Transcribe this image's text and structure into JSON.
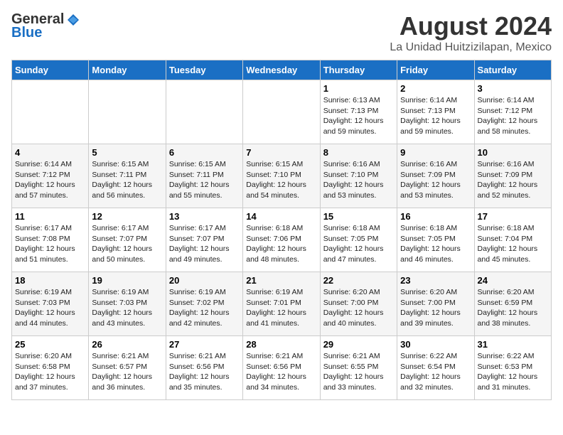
{
  "logo": {
    "general": "General",
    "blue": "Blue",
    "tagline": ""
  },
  "title": "August 2024",
  "subtitle": "La Unidad Huitzizilapan, Mexico",
  "days_of_week": [
    "Sunday",
    "Monday",
    "Tuesday",
    "Wednesday",
    "Thursday",
    "Friday",
    "Saturday"
  ],
  "weeks": [
    [
      {
        "day": "",
        "info": ""
      },
      {
        "day": "",
        "info": ""
      },
      {
        "day": "",
        "info": ""
      },
      {
        "day": "",
        "info": ""
      },
      {
        "day": "1",
        "info": "Sunrise: 6:13 AM\nSunset: 7:13 PM\nDaylight: 12 hours\nand 59 minutes."
      },
      {
        "day": "2",
        "info": "Sunrise: 6:14 AM\nSunset: 7:13 PM\nDaylight: 12 hours\nand 59 minutes."
      },
      {
        "day": "3",
        "info": "Sunrise: 6:14 AM\nSunset: 7:12 PM\nDaylight: 12 hours\nand 58 minutes."
      }
    ],
    [
      {
        "day": "4",
        "info": "Sunrise: 6:14 AM\nSunset: 7:12 PM\nDaylight: 12 hours\nand 57 minutes."
      },
      {
        "day": "5",
        "info": "Sunrise: 6:15 AM\nSunset: 7:11 PM\nDaylight: 12 hours\nand 56 minutes."
      },
      {
        "day": "6",
        "info": "Sunrise: 6:15 AM\nSunset: 7:11 PM\nDaylight: 12 hours\nand 55 minutes."
      },
      {
        "day": "7",
        "info": "Sunrise: 6:15 AM\nSunset: 7:10 PM\nDaylight: 12 hours\nand 54 minutes."
      },
      {
        "day": "8",
        "info": "Sunrise: 6:16 AM\nSunset: 7:10 PM\nDaylight: 12 hours\nand 53 minutes."
      },
      {
        "day": "9",
        "info": "Sunrise: 6:16 AM\nSunset: 7:09 PM\nDaylight: 12 hours\nand 53 minutes."
      },
      {
        "day": "10",
        "info": "Sunrise: 6:16 AM\nSunset: 7:09 PM\nDaylight: 12 hours\nand 52 minutes."
      }
    ],
    [
      {
        "day": "11",
        "info": "Sunrise: 6:17 AM\nSunset: 7:08 PM\nDaylight: 12 hours\nand 51 minutes."
      },
      {
        "day": "12",
        "info": "Sunrise: 6:17 AM\nSunset: 7:07 PM\nDaylight: 12 hours\nand 50 minutes."
      },
      {
        "day": "13",
        "info": "Sunrise: 6:17 AM\nSunset: 7:07 PM\nDaylight: 12 hours\nand 49 minutes."
      },
      {
        "day": "14",
        "info": "Sunrise: 6:18 AM\nSunset: 7:06 PM\nDaylight: 12 hours\nand 48 minutes."
      },
      {
        "day": "15",
        "info": "Sunrise: 6:18 AM\nSunset: 7:05 PM\nDaylight: 12 hours\nand 47 minutes."
      },
      {
        "day": "16",
        "info": "Sunrise: 6:18 AM\nSunset: 7:05 PM\nDaylight: 12 hours\nand 46 minutes."
      },
      {
        "day": "17",
        "info": "Sunrise: 6:18 AM\nSunset: 7:04 PM\nDaylight: 12 hours\nand 45 minutes."
      }
    ],
    [
      {
        "day": "18",
        "info": "Sunrise: 6:19 AM\nSunset: 7:03 PM\nDaylight: 12 hours\nand 44 minutes."
      },
      {
        "day": "19",
        "info": "Sunrise: 6:19 AM\nSunset: 7:03 PM\nDaylight: 12 hours\nand 43 minutes."
      },
      {
        "day": "20",
        "info": "Sunrise: 6:19 AM\nSunset: 7:02 PM\nDaylight: 12 hours\nand 42 minutes."
      },
      {
        "day": "21",
        "info": "Sunrise: 6:19 AM\nSunset: 7:01 PM\nDaylight: 12 hours\nand 41 minutes."
      },
      {
        "day": "22",
        "info": "Sunrise: 6:20 AM\nSunset: 7:00 PM\nDaylight: 12 hours\nand 40 minutes."
      },
      {
        "day": "23",
        "info": "Sunrise: 6:20 AM\nSunset: 7:00 PM\nDaylight: 12 hours\nand 39 minutes."
      },
      {
        "day": "24",
        "info": "Sunrise: 6:20 AM\nSunset: 6:59 PM\nDaylight: 12 hours\nand 38 minutes."
      }
    ],
    [
      {
        "day": "25",
        "info": "Sunrise: 6:20 AM\nSunset: 6:58 PM\nDaylight: 12 hours\nand 37 minutes."
      },
      {
        "day": "26",
        "info": "Sunrise: 6:21 AM\nSunset: 6:57 PM\nDaylight: 12 hours\nand 36 minutes."
      },
      {
        "day": "27",
        "info": "Sunrise: 6:21 AM\nSunset: 6:56 PM\nDaylight: 12 hours\nand 35 minutes."
      },
      {
        "day": "28",
        "info": "Sunrise: 6:21 AM\nSunset: 6:56 PM\nDaylight: 12 hours\nand 34 minutes."
      },
      {
        "day": "29",
        "info": "Sunrise: 6:21 AM\nSunset: 6:55 PM\nDaylight: 12 hours\nand 33 minutes."
      },
      {
        "day": "30",
        "info": "Sunrise: 6:22 AM\nSunset: 6:54 PM\nDaylight: 12 hours\nand 32 minutes."
      },
      {
        "day": "31",
        "info": "Sunrise: 6:22 AM\nSunset: 6:53 PM\nDaylight: 12 hours\nand 31 minutes."
      }
    ]
  ]
}
